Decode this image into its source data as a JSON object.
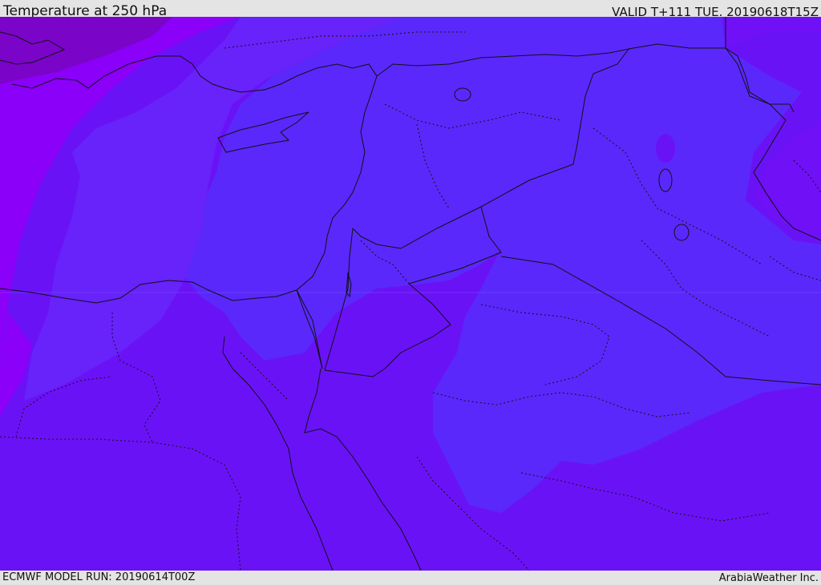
{
  "header": {
    "title": "Temperature at 250 hPa",
    "valid": "VALID T+111 TUE. 20190618T15Z"
  },
  "footer": {
    "model_run": "ECMWF MODEL RUN: 20190614T00Z",
    "brand": "ArabiaWeather Inc."
  },
  "map": {
    "field": "temperature",
    "level": "250 hPa",
    "region": "Eastern Mediterranean, Egypt, Levant, Iraq, northern Saudi Arabia",
    "colors": {
      "coldest": "#7a04c8",
      "cold": "#8a00f8",
      "mid": "#6a12f6",
      "warm": "#5a28fb",
      "boundary": "#111111",
      "gridline": "#8a6cff"
    }
  }
}
